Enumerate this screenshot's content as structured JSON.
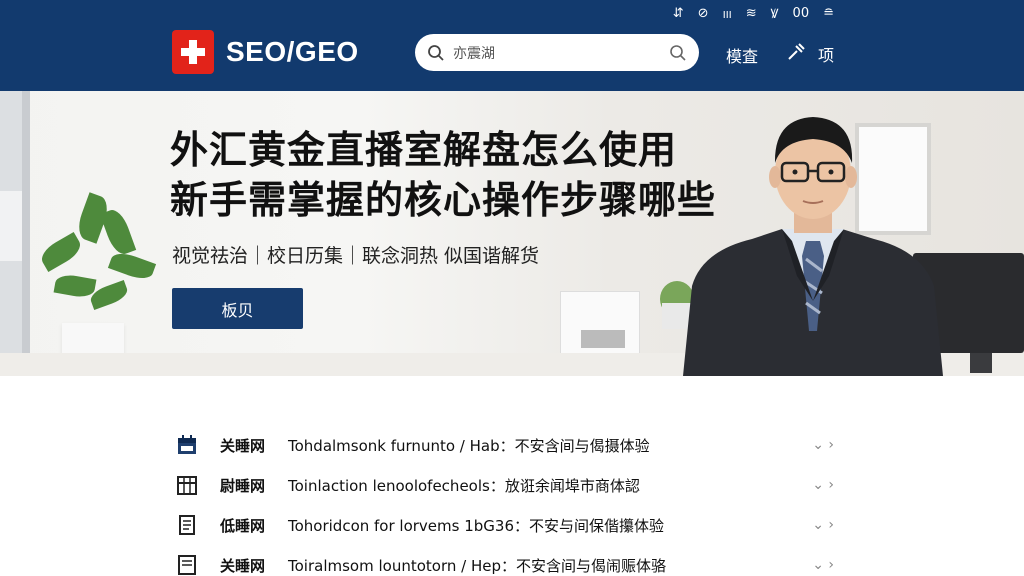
{
  "status_bar": {
    "items": [
      "⇵",
      "⊘",
      "ⲽ",
      "≋",
      "Ꝟ",
      "00",
      "≘"
    ]
  },
  "header": {
    "logo_text": "SEO/GEO",
    "search_placeholder": "亦震湖",
    "login_label": "模査",
    "tool_label": "项"
  },
  "hero": {
    "title_line1": "外汇黄金直播室解盘怎么使用",
    "title_line2": "新手需掌握的核心操作步骤哪些",
    "subtitle": "视觉祛治｜校日历集｜联念洞热 似国谐解货",
    "cta_label": "板贝"
  },
  "list": {
    "items": [
      {
        "icon": "calendar-icon",
        "source": "关睡网",
        "text": "Tohdalmsonk furnunto / Hab：不安含间与偈摄体验"
      },
      {
        "icon": "grid-icon",
        "source": "尉睡网",
        "text": "Toinlaction lenoolofecheols：放诳余闻埠市商体認"
      },
      {
        "icon": "document-icon",
        "source": "低睡网",
        "text": "Tohoridcon for lorvems 1bG36：不安与间保偕攥体验"
      },
      {
        "icon": "list-icon",
        "source": "关睡网",
        "text": "Toiralmsom lountotorn / Hep：不安含间与偈闹赈体骆"
      }
    ]
  },
  "colors": {
    "header_bg": "#123a6e",
    "logo_red": "#e2231a",
    "cta_bg": "#173c6e"
  }
}
